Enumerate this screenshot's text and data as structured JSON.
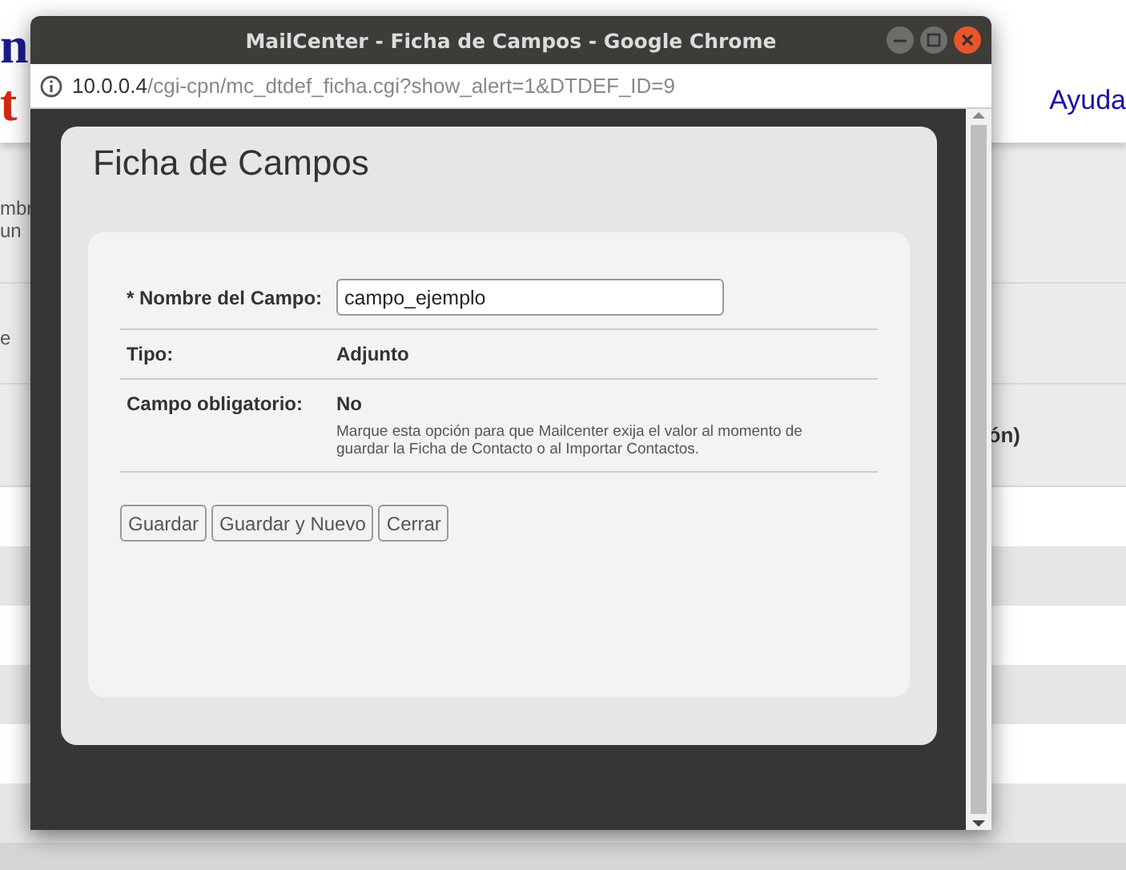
{
  "background": {
    "logo": [
      {
        "text": "n",
        "color": "#1c1c8a"
      },
      {
        "text": "t",
        "color": "#d42a12"
      }
    ],
    "menu": [
      "Ayuda"
    ],
    "rows": [
      {
        "left": [
          "mbr",
          "un"
        ]
      },
      {
        "left": [
          "e"
        ]
      },
      {
        "right": "ón)"
      }
    ]
  },
  "window": {
    "title": "MailCenter - Ficha de Campos - Google Chrome",
    "url_host": "10.0.0.4",
    "url_path": "/cgi-cpn/mc_dtdef_ficha.cgi?show_alert=1&DTDEF_ID=9"
  },
  "form": {
    "title": "Ficha de Campos",
    "fields": [
      {
        "kind": "input",
        "label": "* Nombre del Campo:",
        "value": "campo_ejemplo"
      },
      {
        "kind": "text",
        "label": "Tipo:",
        "value": "Adjunto"
      },
      {
        "kind": "text",
        "label": "Campo obligatorio:",
        "value": "No",
        "help": "Marque esta opción para que Mailcenter exija el valor al momento de guardar la Ficha de Contacto o al Importar Contactos."
      }
    ],
    "buttons": [
      "Guardar",
      "Guardar y Nuevo",
      "Cerrar"
    ]
  }
}
